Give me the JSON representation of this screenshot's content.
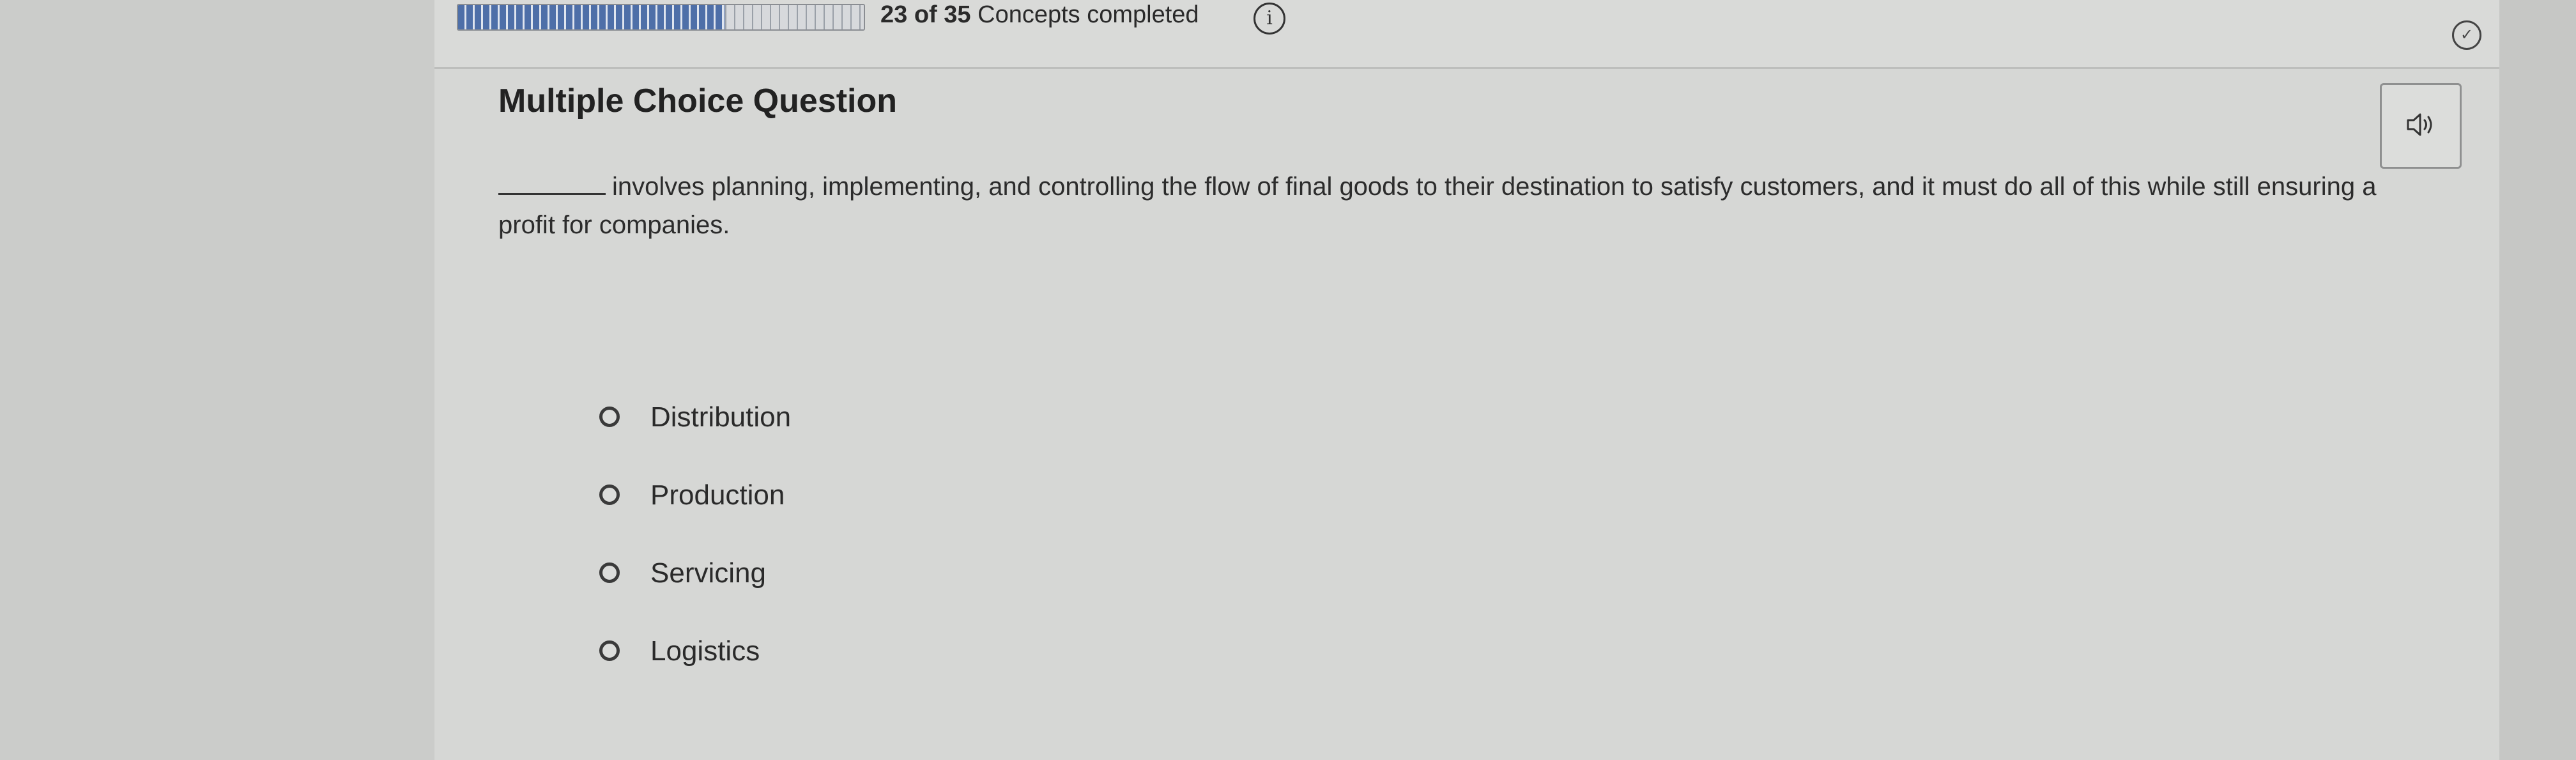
{
  "header": {
    "progress_fraction": 0.657,
    "progress_completed": "23",
    "progress_of_text": "of",
    "progress_total": "35",
    "progress_suffix": "Concepts completed",
    "info_icon": "info-icon",
    "check_icon": "check-circle-icon"
  },
  "question": {
    "type_label": "Multiple Choice Question",
    "stem": "involves planning, implementing, and controlling the flow of final goods to their destination to satisfy customers, and it must do all of this while still ensuring a profit for companies.",
    "audio_icon": "speaker-icon",
    "options": [
      {
        "label": "Distribution"
      },
      {
        "label": "Production"
      },
      {
        "label": "Servicing"
      },
      {
        "label": "Logistics"
      }
    ]
  },
  "colors": {
    "progress_fill": "#4e6fa8",
    "background": "#d6d7d5"
  }
}
